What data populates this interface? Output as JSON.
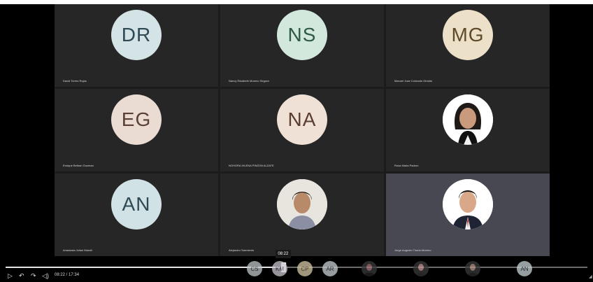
{
  "tiles": [
    {
      "initials": "DR",
      "name": "David Torres Rojas",
      "bg": "#d4e3e6",
      "fg": "#2f4a55"
    },
    {
      "initials": "NS",
      "name": "Nancy Elizabeth Moreno Segura",
      "bg": "#d2e8dc",
      "fg": "#2f5a48"
    },
    {
      "initials": "MG",
      "name": "Manuel Jose Colorado Giraldo",
      "bg": "#ece0c8",
      "fg": "#5e4a2a"
    },
    {
      "initials": "EG",
      "name": "Enrique Beltran Guzman",
      "bg": "#eadbd3",
      "fg": "#5a4035"
    },
    {
      "initials": "NA",
      "name": "NOHORA HILENA PINZON ALZATE",
      "bg": "#f0e1d6",
      "fg": "#5a3e32"
    },
    {
      "initials": "",
      "name": "Rosa Maria Padron",
      "bg": "#ffffff",
      "fg": "#333333"
    },
    {
      "initials": "AN",
      "name": "Anastasia Julian Marulli",
      "bg": "#d1e2e6",
      "fg": "#2f4a55"
    },
    {
      "initials": "",
      "name": "Alejandro Sarmiento",
      "bg": "#ffffff",
      "fg": "#333333"
    },
    {
      "initials": "",
      "name": "Jorge Augusto Tirado Moreno",
      "bg": "#ffffff",
      "fg": "#333333"
    }
  ],
  "player": {
    "current": "08:22",
    "total": "17:34",
    "time_display": "08:22 / 17:34",
    "tooltip": "08:22",
    "progress": 0.477,
    "play_icon": "play-icon",
    "rewind_icon": "rewind-icon",
    "forward_icon": "forward-icon",
    "volume_icon": "volume-icon"
  },
  "strip": [
    {
      "initials": "CS",
      "bg": "#bfc7c9",
      "fg": "#333"
    },
    {
      "initials": "KM",
      "bg": "#c9c4cf",
      "fg": "#333"
    },
    {
      "initials": "CP",
      "bg": "#d6c8a8",
      "fg": "#5a4a2a"
    },
    {
      "initials": "AR",
      "bg": "#c6d0d3",
      "fg": "#333"
    },
    {
      "initials": "",
      "bg": "#444",
      "fg": "#333"
    },
    {
      "initials": "",
      "bg": "#444",
      "fg": "#333"
    },
    {
      "initials": "",
      "bg": "#444",
      "fg": "#333"
    },
    {
      "initials": "AN",
      "bg": "#c7d3d6",
      "fg": "#333"
    }
  ]
}
